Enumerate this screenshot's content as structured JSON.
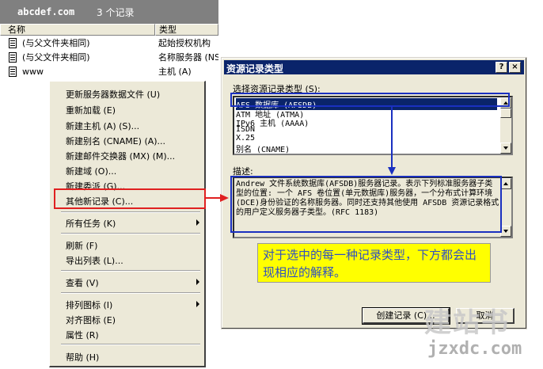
{
  "mmc": {
    "zone_name": "abcdef.com",
    "record_count": "3 个记录",
    "columns": {
      "name": "名称",
      "type": "类型"
    },
    "rows": [
      {
        "name": "(与父文件夹相同)",
        "type": "起始授权机构"
      },
      {
        "name": "(与父文件夹相同)",
        "type": "名称服务器 (NS)"
      },
      {
        "name": "www",
        "type": "主机 (A)"
      }
    ]
  },
  "context_menu": {
    "items": [
      "更新服务器数据文件 (U)",
      "重新加载 (E)",
      "新建主机 (A) (S)...",
      "新建别名 (CNAME) (A)...",
      "新建邮件交换器 (MX) (M)...",
      "新建域 (O)...",
      "新建委派 (G)...",
      "其他新记录 (C)...",
      "所有任务 (K)",
      "刷新 (F)",
      "导出列表 (L)...",
      "查看 (V)",
      "排列图标 (I)",
      "对齐图标 (E)",
      "属性 (R)",
      "帮助 (H)"
    ]
  },
  "dialog": {
    "title": "资源记录类型",
    "help_btn": "?",
    "close_btn": "×",
    "select_label": "选择资源记录类型 (S):",
    "record_types": [
      "AFS 数据库 (AFSDB)",
      "ATM 地址 (ATMA)",
      "IPv6 主机 (AAAA)",
      "ISDN",
      "X.25",
      "别名 (CNAME)"
    ],
    "desc_label": "描述:",
    "description": "Andrew 文件系统数据库(AFSDB)服务器记录。表示下列标准服务器子类型的位置: 一个 AFS 卷位置(单元数据库)服务器，一个分布式计算环境(DCE)身份验证的名称服务器。同时还支持其他使用 AFSDB 资源记录格式的用户定义服务器子类型。(RFC 1183)",
    "create_btn": "创建记录 (C)...",
    "cancel_btn": "取消"
  },
  "annotation": {
    "note": "对于选中的每一种记录类型，下方都会出现相应的解释。",
    "colors": {
      "red": "#e02020",
      "blue": "#1a30c0",
      "note_bg": "#ffff00"
    }
  },
  "watermark": {
    "text1": "建站书",
    "text2": "jzxdc.com"
  }
}
